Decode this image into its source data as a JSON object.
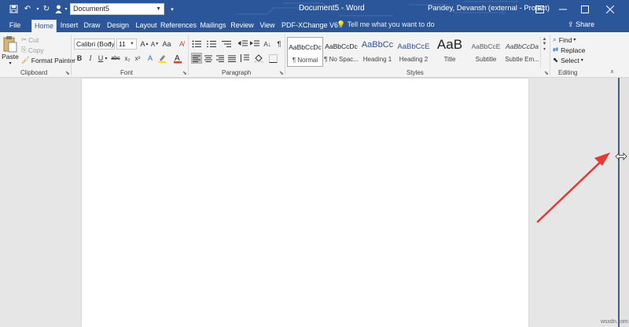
{
  "titlebar": {
    "doc_name": "Document5",
    "app_title": "Document5  -  Word",
    "user": "Pandey, Devansh (external - Project)",
    "bg_color": "#2b579a"
  },
  "tabs": [
    "File",
    "Home",
    "Insert",
    "Draw",
    "Design",
    "Layout",
    "References",
    "Mailings",
    "Review",
    "View",
    "PDF-XChange V6"
  ],
  "active_tab": "Home",
  "tell_me": "Tell me what you want to do",
  "share": "Share",
  "clipboard": {
    "paste": "Paste",
    "cut": "Cut",
    "copy": "Copy",
    "format_painter": "Format Painter",
    "label": "Clipboard"
  },
  "font": {
    "name": "Calibri (Body)",
    "size": "11",
    "label": "Font"
  },
  "paragraph": {
    "label": "Paragraph"
  },
  "styles": {
    "label": "Styles",
    "items": [
      {
        "preview": "AaBbCcDc",
        "name": "¶ Normal"
      },
      {
        "preview": "AaBbCcDc",
        "name": "¶ No Spac..."
      },
      {
        "preview": "AaBbCc",
        "name": "Heading 1"
      },
      {
        "preview": "AaBbCcE",
        "name": "Heading 2"
      },
      {
        "preview": "AaB",
        "name": "Title"
      },
      {
        "preview": "AaBbCcE",
        "name": "Subtitle"
      },
      {
        "preview": "AaBbCcDa",
        "name": "Subtle Em..."
      }
    ]
  },
  "editing": {
    "find": "Find",
    "replace": "Replace",
    "select": "Select",
    "label": "Editing"
  },
  "watermark": "wsxdn.com",
  "accent_color": "#e53935"
}
